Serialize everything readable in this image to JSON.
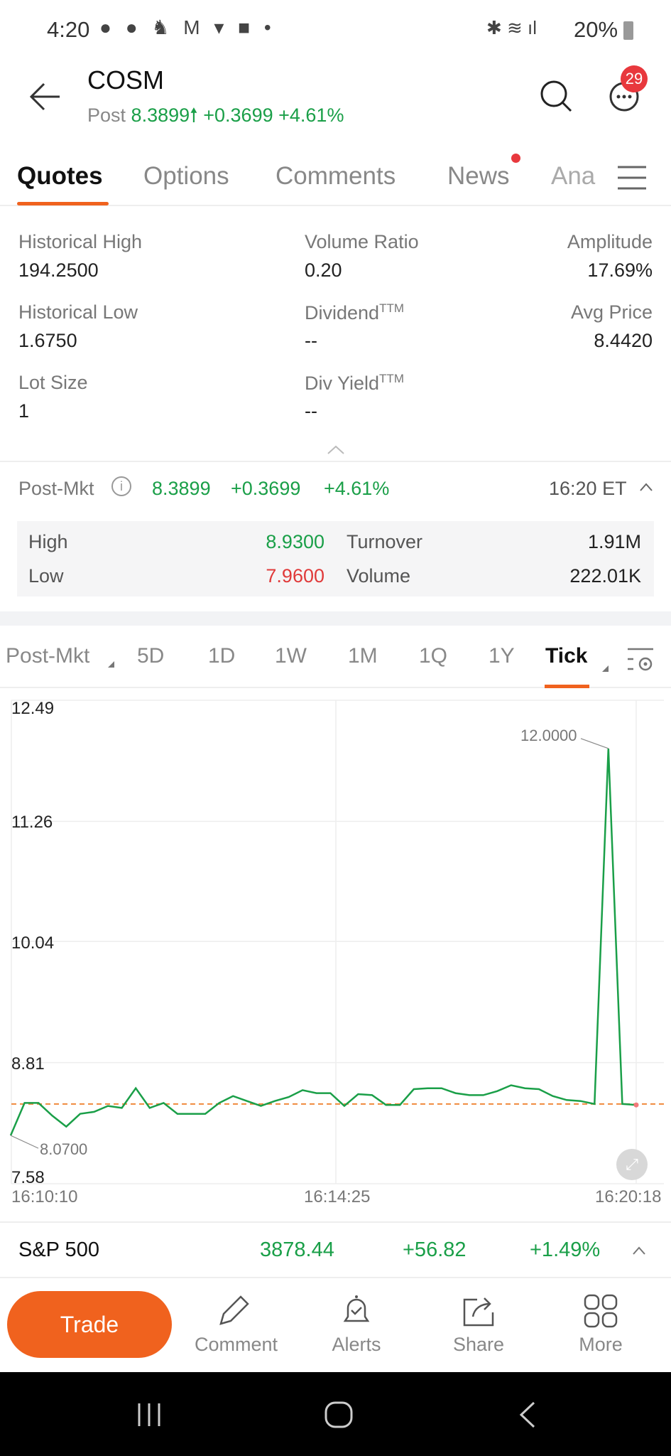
{
  "status_bar": {
    "time": "4:20",
    "battery": "20%"
  },
  "header": {
    "symbol": "COSM",
    "session": "Post",
    "price": "8.3899",
    "change": "+0.3699",
    "change_pct": "+4.61%",
    "notification_count": "29"
  },
  "tabs": [
    {
      "label": "Quotes",
      "active": true
    },
    {
      "label": "Options"
    },
    {
      "label": "Comments"
    },
    {
      "label": "News",
      "dot": true
    },
    {
      "label": "Ana"
    }
  ],
  "stats": [
    {
      "label": "Historical High",
      "value": "194.2500"
    },
    {
      "label": "Volume Ratio",
      "value": "0.20"
    },
    {
      "label": "Amplitude",
      "value": "17.69%"
    },
    {
      "label": "Historical Low",
      "value": "1.6750"
    },
    {
      "label": "Dividend",
      "sup": "TTM",
      "value": "--"
    },
    {
      "label": "Avg Price",
      "value": "8.4420"
    },
    {
      "label": "Lot Size",
      "value": "1"
    },
    {
      "label": "Div Yield",
      "sup": "TTM",
      "value": "--"
    }
  ],
  "post_market": {
    "label": "Post-Mkt",
    "price": "8.3899",
    "change": "+0.3699",
    "change_pct": "+4.61%",
    "time": "16:20 ET",
    "high_label": "High",
    "high": "8.9300",
    "low_label": "Low",
    "low": "7.9600",
    "turnover_label": "Turnover",
    "turnover": "1.91M",
    "volume_label": "Volume",
    "volume": "222.01K"
  },
  "period_tabs": [
    "Post-Mkt",
    "5D",
    "1D",
    "1W",
    "1M",
    "1Q",
    "1Y",
    "Tick"
  ],
  "active_period": "Tick",
  "chart_data": {
    "type": "line",
    "y_ticks": [
      "12.49",
      "11.26",
      "10.04",
      "8.81",
      "7.58"
    ],
    "ylim": [
      7.58,
      12.49
    ],
    "x_ticks": [
      "16:10:10",
      "16:14:25",
      "16:20:18"
    ],
    "reference_price": 8.39,
    "max_label": "12.0000",
    "min_label": "8.0700",
    "line_color": "#1a9f48",
    "reference_color": "#f08a3c",
    "values": [
      8.07,
      8.4,
      8.4,
      8.27,
      8.16,
      8.29,
      8.31,
      8.37,
      8.35,
      8.55,
      8.35,
      8.4,
      8.29,
      8.29,
      8.29,
      8.4,
      8.47,
      8.42,
      8.37,
      8.42,
      8.46,
      8.53,
      8.5,
      8.5,
      8.37,
      8.49,
      8.48,
      8.38,
      8.38,
      8.54,
      8.55,
      8.55,
      8.5,
      8.48,
      8.48,
      8.52,
      8.58,
      8.55,
      8.54,
      8.47,
      8.43,
      8.42,
      8.39,
      12.0,
      8.39,
      8.38
    ]
  },
  "index_bar": {
    "name": "S&P 500",
    "price": "3878.44",
    "change": "+56.82",
    "change_pct": "+1.49%"
  },
  "bottom": {
    "trade": "Trade",
    "items": [
      "Comment",
      "Alerts",
      "Share",
      "More"
    ]
  },
  "colors": {
    "accent": "#f0621e",
    "up": "#1a9f48",
    "down": "#e03a3a"
  }
}
